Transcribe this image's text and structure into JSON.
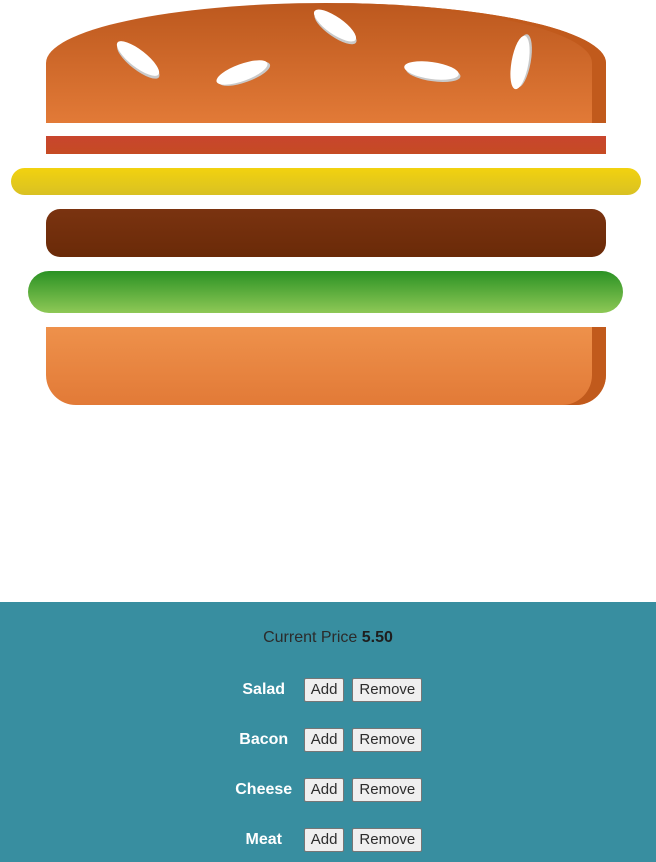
{
  "price": {
    "label": "Current Price",
    "value": "5.50"
  },
  "ingredients": [
    {
      "name": "Salad",
      "add": "Add",
      "remove": "Remove"
    },
    {
      "name": "Bacon",
      "add": "Add",
      "remove": "Remove"
    },
    {
      "name": "Cheese",
      "add": "Add",
      "remove": "Remove"
    },
    {
      "name": "Meat",
      "add": "Add",
      "remove": "Remove"
    }
  ],
  "colors": {
    "bread": "#e27a37",
    "bacon": "#c8452e",
    "cheese": "#f2d20f",
    "meat": "#7a3310",
    "salad": "#2b9224",
    "controls_bg": "#388ea0"
  }
}
